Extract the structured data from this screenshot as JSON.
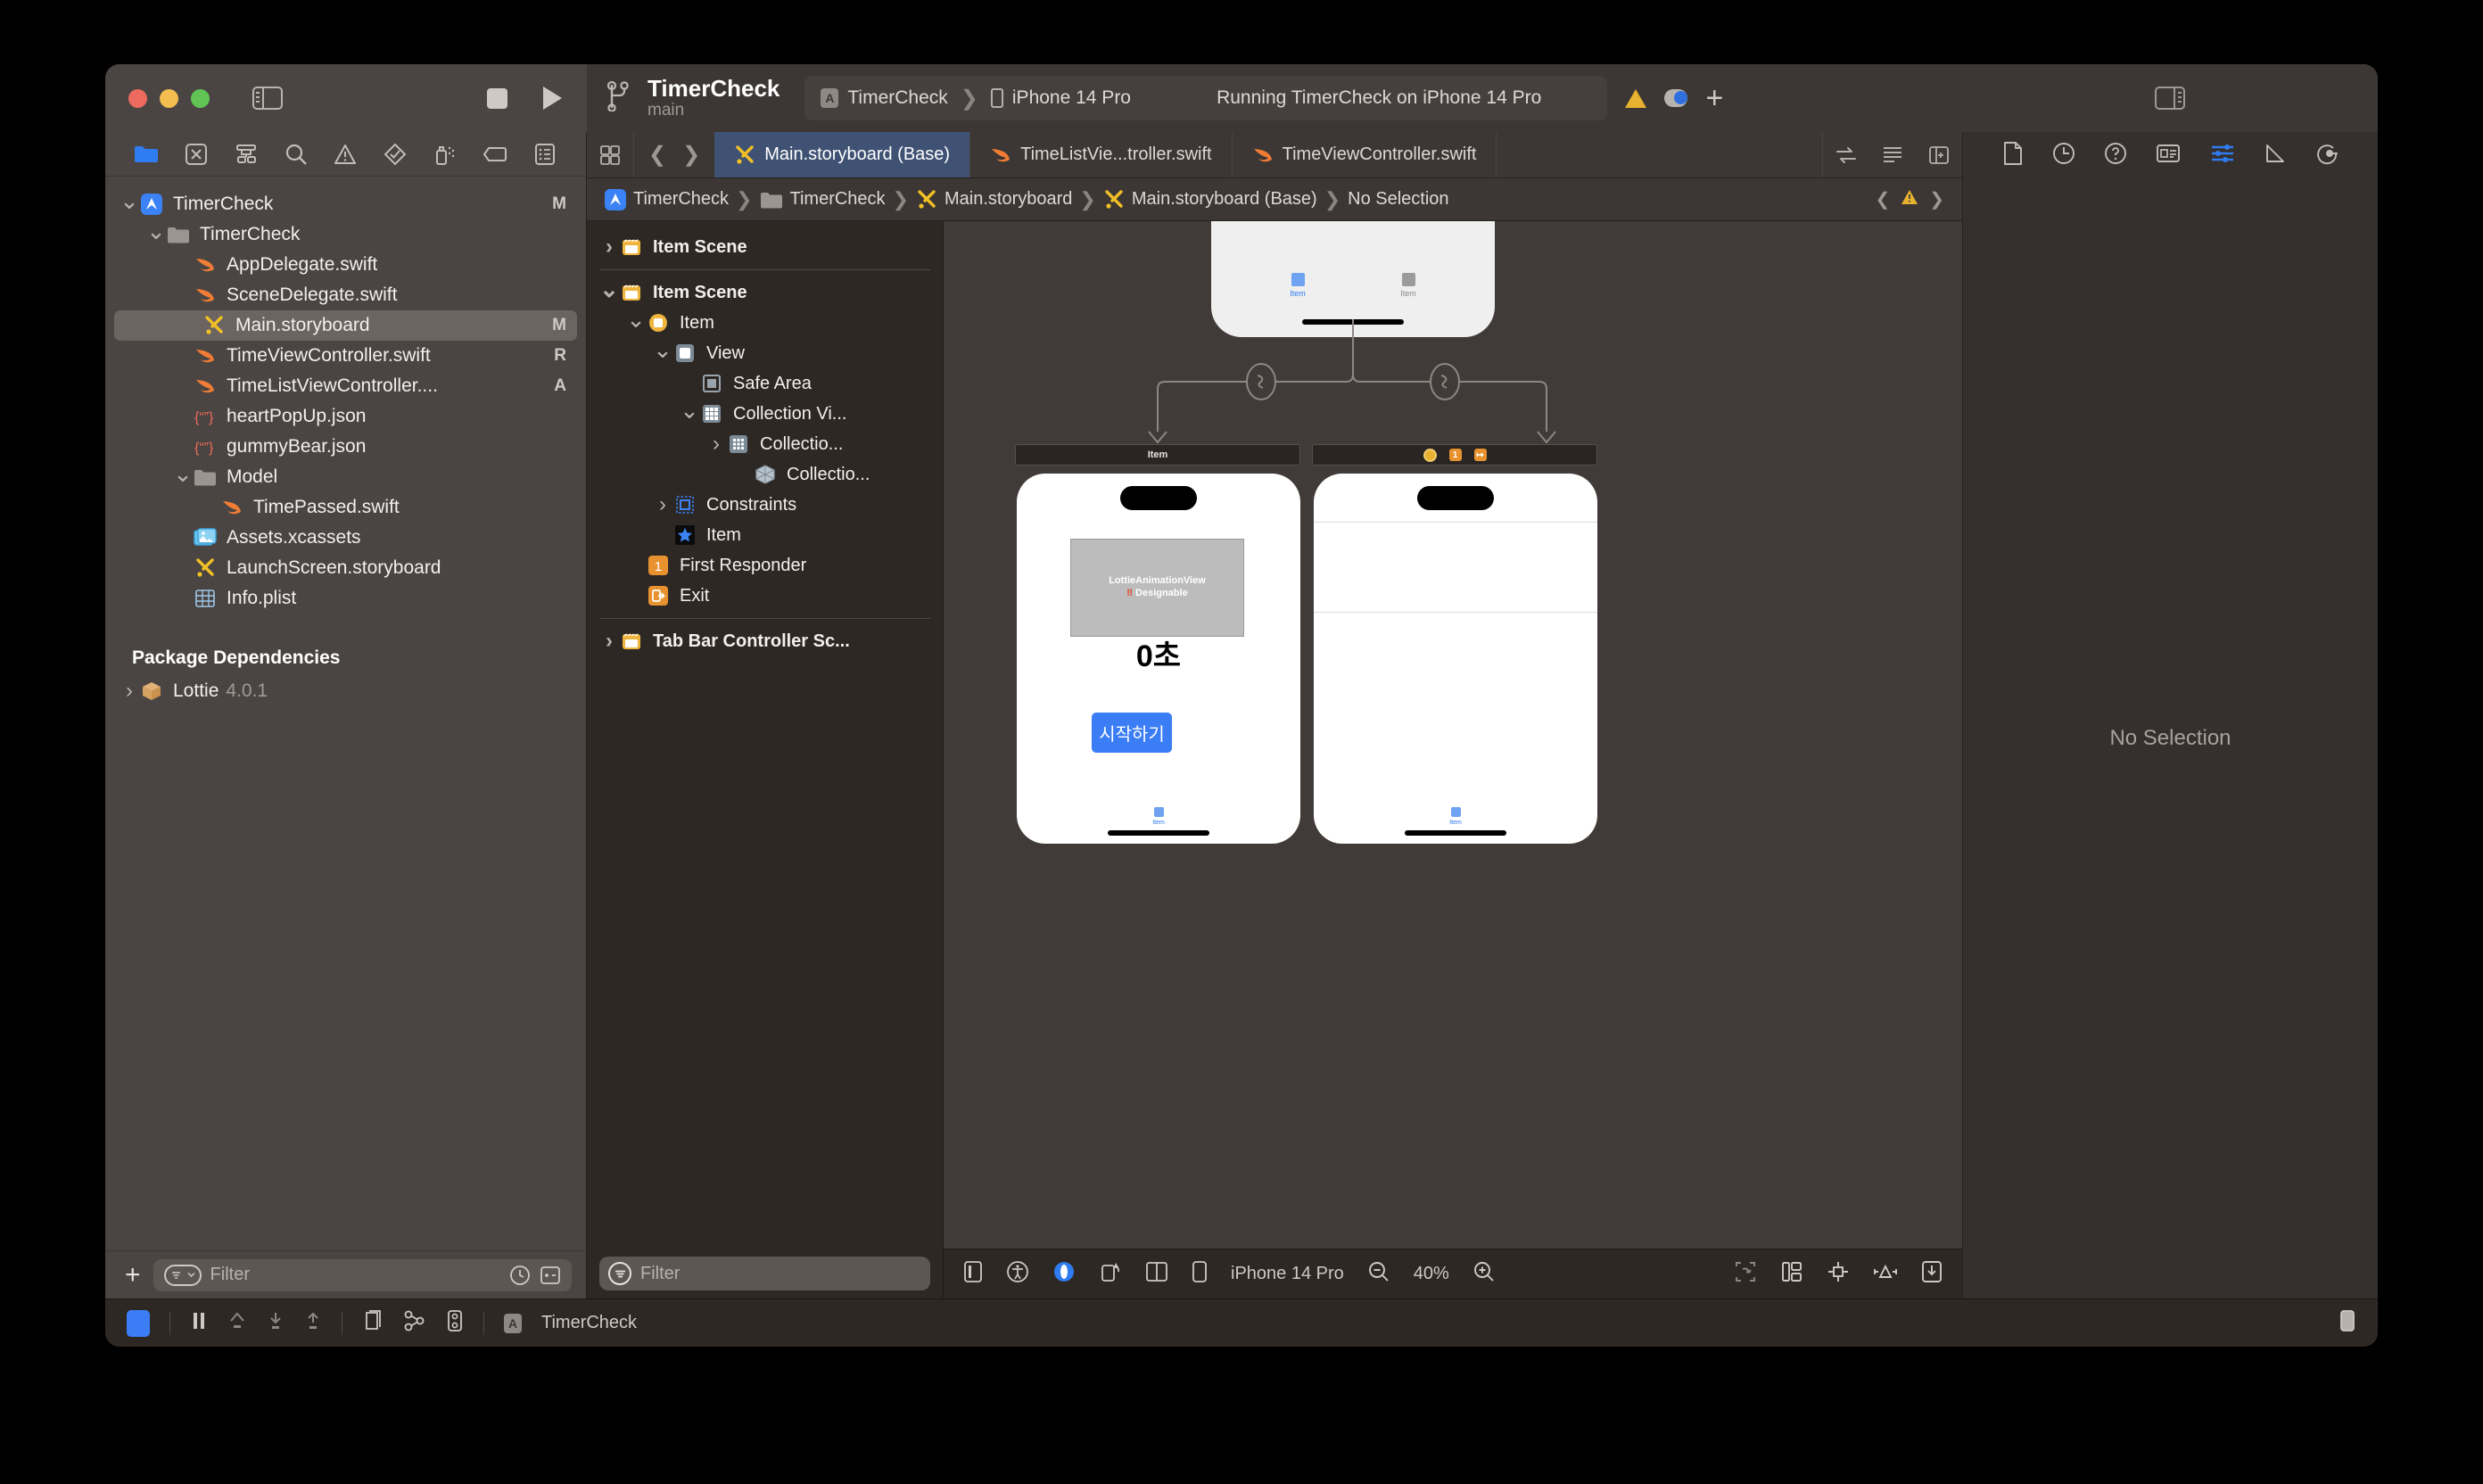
{
  "window": {
    "traffic_lights": [
      "close",
      "minimize",
      "zoom"
    ]
  },
  "toolbar": {
    "project_name": "TimerCheck",
    "branch": "main",
    "scheme_name": "TimerCheck",
    "destination": "iPhone 14 Pro",
    "status": "Running TimerCheck on iPhone 14 Pro",
    "icons": [
      "sidebar-toggle-icon",
      "stop-icon",
      "run-icon",
      "warning-icon",
      "cloud-icon",
      "plus-icon",
      "inspector-toggle-icon"
    ]
  },
  "navigator": {
    "icons": [
      "folder-icon",
      "source-control-icon",
      "symbol-hierarchy-icon",
      "search-icon",
      "issue-warning-icon",
      "test-diamond-icon",
      "debug-spray-icon",
      "breakpoint-tag-icon",
      "report-list-icon"
    ],
    "tree": [
      {
        "label": "TimerCheck",
        "badge": "M",
        "indent": 0,
        "twisty": "down",
        "icon": "xcode-project-icon",
        "selected": false
      },
      {
        "label": "TimerCheck",
        "badge": "",
        "indent": 1,
        "twisty": "down",
        "icon": "folder-icon",
        "selected": false
      },
      {
        "label": "AppDelegate.swift",
        "badge": "",
        "indent": 2,
        "twisty": "",
        "icon": "swift-icon",
        "selected": false
      },
      {
        "label": "SceneDelegate.swift",
        "badge": "",
        "indent": 2,
        "twisty": "",
        "icon": "swift-icon",
        "selected": false
      },
      {
        "label": "Main.storyboard",
        "badge": "M",
        "indent": 2,
        "twisty": "",
        "icon": "storyboard-icon",
        "selected": true
      },
      {
        "label": "TimeViewController.swift",
        "badge": "R",
        "indent": 2,
        "twisty": "",
        "icon": "swift-icon",
        "selected": false
      },
      {
        "label": "TimeListViewController....",
        "badge": "A",
        "indent": 2,
        "twisty": "",
        "icon": "swift-icon",
        "selected": false
      },
      {
        "label": "heartPopUp.json",
        "badge": "",
        "indent": 2,
        "twisty": "",
        "icon": "json-icon",
        "selected": false
      },
      {
        "label": "gummyBear.json",
        "badge": "",
        "indent": 2,
        "twisty": "",
        "icon": "json-icon",
        "selected": false
      },
      {
        "label": "Model",
        "badge": "",
        "indent": 2,
        "twisty": "down",
        "icon": "folder-icon",
        "selected": false
      },
      {
        "label": "TimePassed.swift",
        "badge": "",
        "indent": 3,
        "twisty": "",
        "icon": "swift-icon",
        "selected": false
      },
      {
        "label": "Assets.xcassets",
        "badge": "",
        "indent": 2,
        "twisty": "",
        "icon": "assets-icon",
        "selected": false
      },
      {
        "label": "LaunchScreen.storyboard",
        "badge": "",
        "indent": 2,
        "twisty": "",
        "icon": "storyboard-icon",
        "selected": false
      },
      {
        "label": "Info.plist",
        "badge": "",
        "indent": 2,
        "twisty": "",
        "icon": "plist-icon",
        "selected": false
      }
    ],
    "package_section_title": "Package Dependencies",
    "packages": [
      {
        "label": "Lottie",
        "version": "4.0.1",
        "twisty": "right",
        "icon": "package-icon"
      }
    ],
    "filter_placeholder": "Filter"
  },
  "editor": {
    "tabs": [
      {
        "label": "Main.storyboard (Base)",
        "icon": "storyboard-icon",
        "active": true
      },
      {
        "label": "TimeListVie...troller.swift",
        "icon": "swift-icon",
        "active": false
      },
      {
        "label": "TimeViewController.swift",
        "icon": "swift-icon",
        "active": false
      }
    ],
    "breadcrumb": [
      {
        "label": "TimerCheck",
        "icon": "xcode-project-icon"
      },
      {
        "label": "TimerCheck",
        "icon": "folder-icon"
      },
      {
        "label": "Main.storyboard",
        "icon": "storyboard-icon"
      },
      {
        "label": "Main.storyboard (Base)",
        "icon": "storyboard-icon"
      },
      {
        "label": "No Selection",
        "icon": ""
      }
    ]
  },
  "outline": {
    "rows": [
      {
        "label": "Item Scene",
        "indent": 0,
        "twisty": "right",
        "icon": "scene-icon",
        "bold": true,
        "divider_after": true
      },
      {
        "label": "Item Scene",
        "indent": 0,
        "twisty": "down",
        "icon": "scene-icon",
        "bold": true,
        "divider_after": false
      },
      {
        "label": "Item",
        "indent": 1,
        "twisty": "down",
        "icon": "view-controller-icon",
        "bold": false,
        "divider_after": false
      },
      {
        "label": "View",
        "indent": 2,
        "twisty": "down",
        "icon": "view-icon",
        "bold": false,
        "divider_after": false
      },
      {
        "label": "Safe Area",
        "indent": 3,
        "twisty": "",
        "icon": "safe-area-icon",
        "bold": false,
        "divider_after": false
      },
      {
        "label": "Collection Vi...",
        "indent": 3,
        "twisty": "down",
        "icon": "collection-view-icon",
        "bold": false,
        "divider_after": false
      },
      {
        "label": "Collectio...",
        "indent": 4,
        "twisty": "right",
        "icon": "collection-cell-icon",
        "bold": false,
        "divider_after": false
      },
      {
        "label": "Collectio...",
        "indent": 5,
        "twisty": "",
        "icon": "flow-layout-icon",
        "bold": false,
        "divider_after": false
      },
      {
        "label": "Constraints",
        "indent": 2,
        "twisty": "right",
        "icon": "constraints-icon",
        "bold": false,
        "divider_after": false
      },
      {
        "label": "Item",
        "indent": 2,
        "twisty": "",
        "icon": "tab-bar-item-icon",
        "bold": false,
        "divider_after": false
      },
      {
        "label": "First Responder",
        "indent": 1,
        "twisty": "",
        "icon": "first-responder-icon",
        "bold": false,
        "divider_after": false
      },
      {
        "label": "Exit",
        "indent": 1,
        "twisty": "",
        "icon": "exit-icon",
        "bold": false,
        "divider_after": true
      },
      {
        "label": "Tab Bar Controller Sc...",
        "indent": 0,
        "twisty": "right",
        "icon": "scene-icon",
        "bold": true,
        "divider_after": false
      }
    ],
    "filter_placeholder": "Filter"
  },
  "canvas": {
    "tab_bar_scene": {
      "items": [
        {
          "label": "Item",
          "selected": true
        },
        {
          "label": "Item",
          "selected": false
        }
      ]
    },
    "scene_left": {
      "title": "Item"
    },
    "scene_right": {
      "badges": [
        "view-controller-icon",
        "first-responder-icon",
        "exit-icon"
      ]
    },
    "phone_left": {
      "lottie_line1": "LottieAnimationView",
      "lottie_bang": "‼️",
      "lottie_line2": "Designable",
      "counter_label": "0초",
      "start_button_label": "시작하기",
      "tab_item_label": "Item"
    },
    "phone_right": {
      "tab_item_label": "Item"
    },
    "bottom_bar": {
      "device": "iPhone 14 Pro",
      "zoom": "40%",
      "icons_left": [
        "view-as-icon",
        "accessibility-icon",
        "variants-icon",
        "orientation-icon",
        "split-view-icon",
        "device-icon"
      ],
      "icons_right": [
        "update-frames-icon",
        "embed-icon",
        "align-icon",
        "add-constraints-icon",
        "resolve-issues-icon"
      ]
    }
  },
  "inspector": {
    "icons": [
      "file-inspector-icon",
      "history-inspector-icon",
      "quick-help-icon",
      "identity-inspector-icon",
      "attributes-inspector-icon",
      "size-inspector-icon",
      "connections-inspector-icon"
    ],
    "empty_state": "No Selection"
  },
  "statusbar": {
    "scheme_label": "TimerCheck",
    "icons": [
      "activity-icon",
      "pause-icon",
      "step-over-icon",
      "step-into-icon",
      "step-out-icon",
      "view-hierarchy-icon",
      "memory-graph-icon",
      "environment-icon",
      "app-icon",
      "device-console-icon"
    ]
  }
}
